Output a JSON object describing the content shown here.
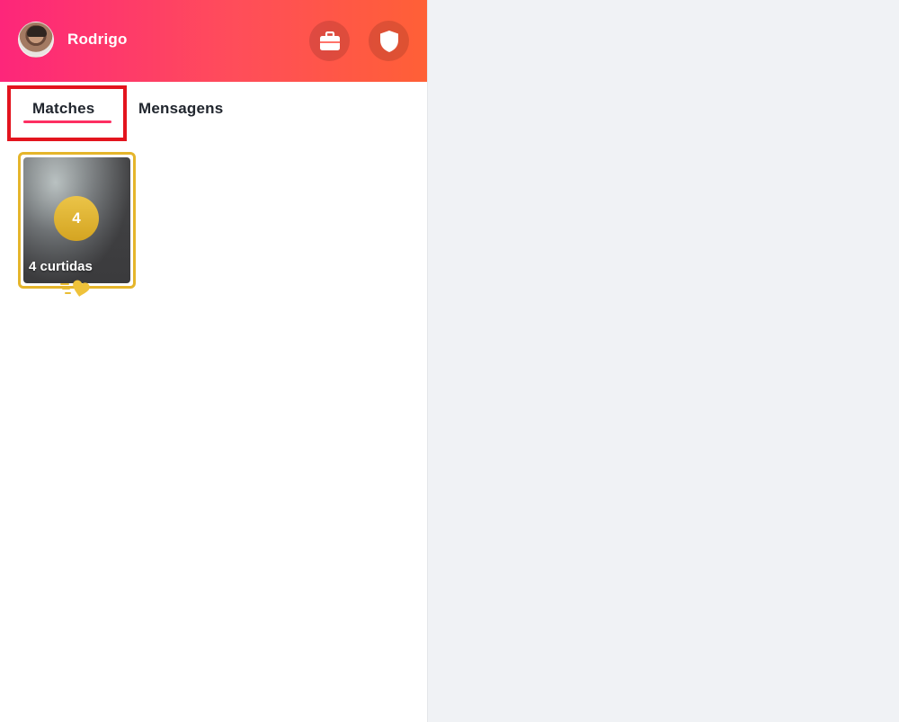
{
  "header": {
    "profile_name": "Rodrigo",
    "work_icon": "briefcase-icon",
    "safety_icon": "shield-icon"
  },
  "tabs": [
    {
      "label": "Matches",
      "active": true
    },
    {
      "label": "Mensagens",
      "active": false
    }
  ],
  "likes_card": {
    "count": "4",
    "label": "4 curtidas",
    "icon": "gold-heart-icon"
  },
  "colors": {
    "header_gradient_start": "#fd267a",
    "header_gradient_end": "#ff6036",
    "tab_underline": "#fd2f62",
    "gold": "#e5b52b",
    "highlight": "#e3141e",
    "main_background": "#f0f2f5"
  }
}
